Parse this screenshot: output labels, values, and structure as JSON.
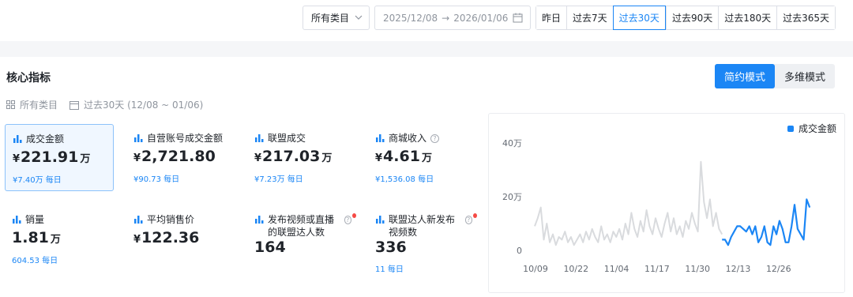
{
  "filters": {
    "category": "所有类目",
    "date_start": "2025/12/08",
    "date_end": "2026/01/06",
    "periods": [
      "昨日",
      "过去7天",
      "过去30天",
      "过去90天",
      "过去180天",
      "过去365天"
    ],
    "active_period": "过去30天"
  },
  "section": {
    "title": "核心指标",
    "modes": [
      "简约模式",
      "多维模式"
    ],
    "active_mode": "简约模式",
    "meta_category": "所有类目",
    "meta_period": "过去30天 (12/08 ~ 01/06)"
  },
  "metrics": [
    {
      "label": "成交金额",
      "currency": "¥",
      "value": "221.91",
      "unit": "万",
      "sub": "¥7.40万 每日",
      "selected": true,
      "help": false,
      "dot": false
    },
    {
      "label": "自营账号成交金额",
      "currency": "¥",
      "value": "2,721.80",
      "unit": "",
      "sub": "¥90.73 每日",
      "selected": false,
      "help": false,
      "dot": false
    },
    {
      "label": "联盟成交",
      "currency": "¥",
      "value": "217.03",
      "unit": "万",
      "sub": "¥7.23万 每日",
      "selected": false,
      "help": false,
      "dot": false
    },
    {
      "label": "商城收入",
      "currency": "¥",
      "value": "4.61",
      "unit": "万",
      "sub": "¥1,536.08 每日",
      "selected": false,
      "help": true,
      "dot": false
    },
    {
      "label": "销量",
      "currency": "",
      "value": "1.81",
      "unit": "万",
      "sub": "604.53 每日",
      "selected": false,
      "help": false,
      "dot": false
    },
    {
      "label": "平均销售价",
      "currency": "¥",
      "value": "122.36",
      "unit": "",
      "sub": "",
      "selected": false,
      "help": false,
      "dot": false
    },
    {
      "label": "发布视频或直播的联盟达人数",
      "currency": "",
      "value": "164",
      "unit": "",
      "sub": "",
      "selected": false,
      "help": true,
      "dot": true
    },
    {
      "label": "联盟达人新发布视频数",
      "currency": "",
      "value": "336",
      "unit": "",
      "sub": "11 每日",
      "selected": false,
      "help": true,
      "dot": true
    }
  ],
  "colors": {
    "accent": "#1b86f5",
    "history_line": "#d9dbde",
    "alert_dot": "#f54a45"
  },
  "chart_data": {
    "type": "line",
    "legend": "成交金额",
    "legend_position": "top-right",
    "y_ticks": [
      "40万",
      "20万",
      "0"
    ],
    "ylim": [
      0,
      40
    ],
    "y_unit": "万",
    "x_ticks": [
      "10/09",
      "10/22",
      "11/04",
      "11/17",
      "11/30",
      "12/13",
      "12/26"
    ],
    "series": [
      {
        "name": "",
        "style": "past (grey)",
        "values": [
          9,
          12,
          16,
          4,
          10,
          3,
          6,
          2,
          5,
          4,
          7,
          3,
          5,
          2,
          4,
          6,
          3,
          7,
          4,
          8,
          5,
          3,
          9,
          4,
          6,
          3,
          7,
          5,
          8,
          4,
          10,
          6,
          14,
          8,
          5,
          11,
          7,
          15,
          9,
          6,
          12,
          8,
          5,
          10,
          14,
          7,
          12,
          6,
          9,
          5,
          11,
          8,
          14,
          10,
          7,
          33,
          18,
          12,
          19,
          9,
          14,
          8,
          6
        ]
      },
      {
        "name": "成交金额",
        "style": "current (blue)",
        "values": [
          4,
          4,
          2,
          5,
          7,
          9,
          9,
          8,
          7,
          9,
          6,
          9,
          3,
          5,
          9,
          3,
          2,
          9,
          6,
          11,
          8,
          3,
          3,
          9,
          17,
          8,
          6,
          4,
          19,
          16
        ]
      }
    ]
  }
}
